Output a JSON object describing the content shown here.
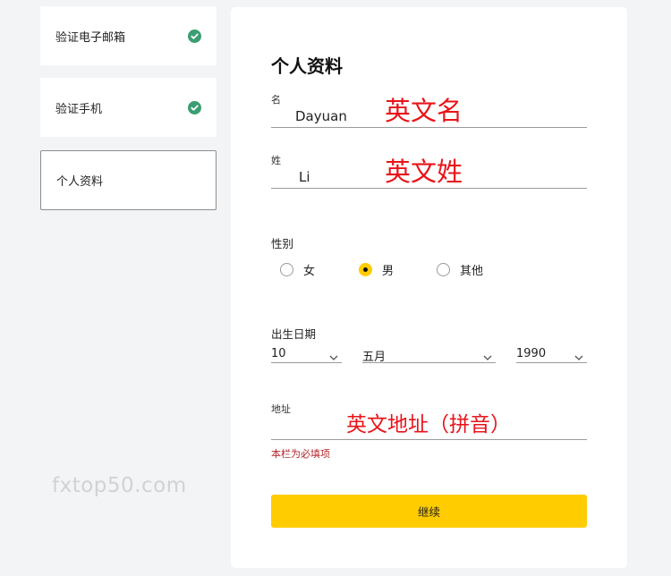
{
  "steps": [
    {
      "label": "验证电子邮箱",
      "completed": true
    },
    {
      "label": "验证手机",
      "completed": true
    },
    {
      "label": "个人资料",
      "completed": false,
      "active": true
    }
  ],
  "watermark": "fxtop50.com",
  "form": {
    "title": "个人资料",
    "first_name": {
      "label": "名",
      "value": "Dayuan",
      "annotation": "英文名"
    },
    "last_name": {
      "label": "姓",
      "value": "Li",
      "annotation": "英文姓"
    },
    "gender": {
      "label": "性别",
      "options": [
        "女",
        "男",
        "其他"
      ],
      "selected": "男"
    },
    "birth_date": {
      "label": "出生日期",
      "day": "10",
      "month": "五月",
      "year": "1990"
    },
    "address": {
      "label": "地址",
      "value": "",
      "annotation": "英文地址（拼音）",
      "error": "本栏为必填项"
    },
    "continue_label": "继续"
  },
  "colors": {
    "accent_yellow": "#ffcc00",
    "check_green": "#3a9e73",
    "error_red": "#b3282d",
    "annotation_red": "#e8141a",
    "background": "#f3f4f6"
  }
}
